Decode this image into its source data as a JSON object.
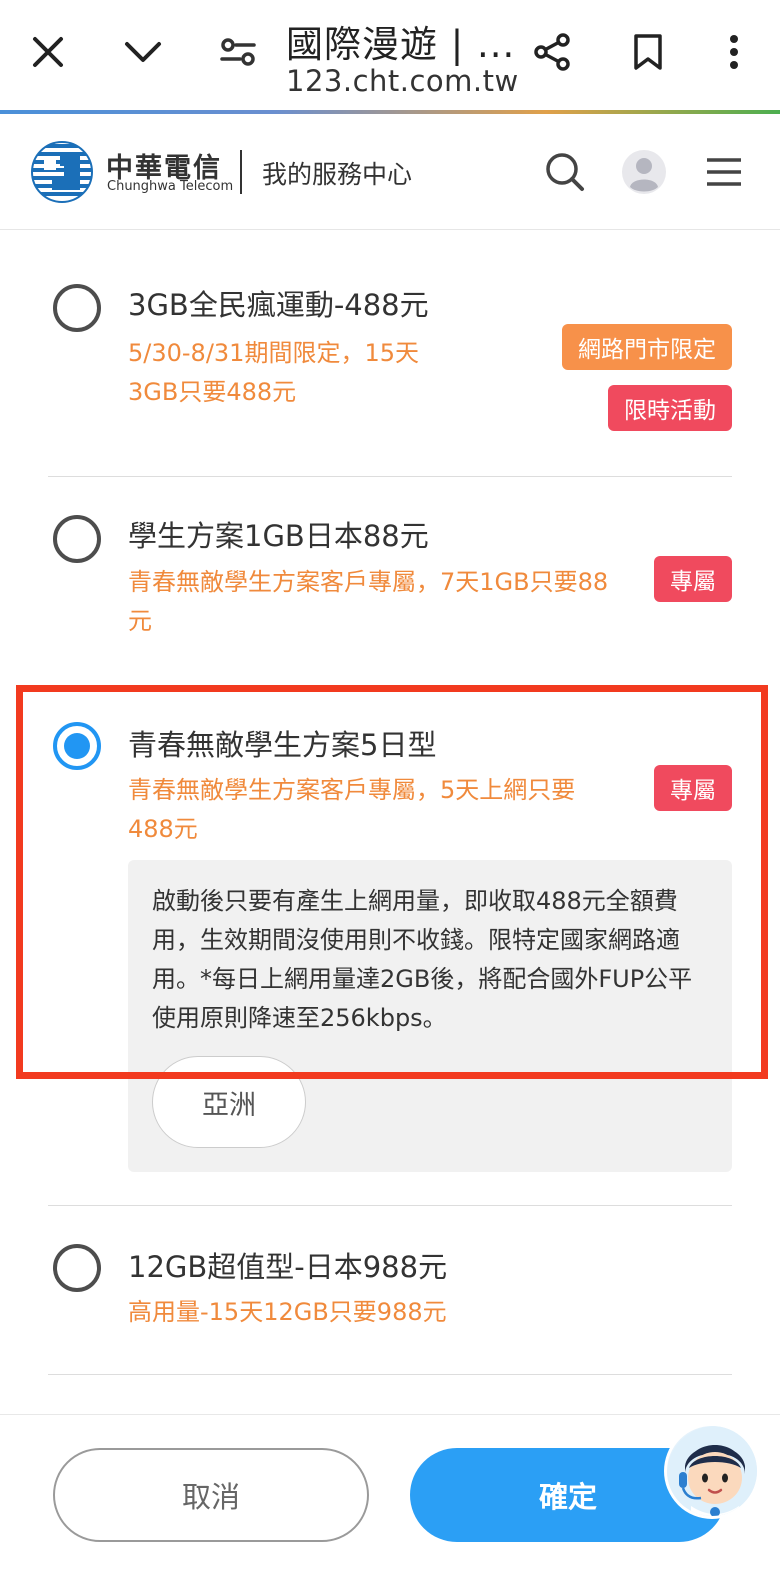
{
  "browser": {
    "title": "國際漫遊 | ...",
    "url": "123.cht.com.tw"
  },
  "header": {
    "brand_cn": "中華電信",
    "brand_en": "Chunghwa Telecom",
    "service_title": "我的服務中心"
  },
  "plans": [
    {
      "name": "3GB全民瘋運動-488元",
      "desc": "5/30-8/31期間限定，15天3GB只要488元",
      "badges": [
        "網路門市限定",
        "限時活動"
      ],
      "selected": false
    },
    {
      "name": "學生方案1GB日本88元",
      "desc": "青春無敵學生方案客戶專屬，7天1GB只要88元",
      "badges": [
        "專屬"
      ],
      "selected": false
    },
    {
      "name": "青春無敵學生方案5日型",
      "desc": "青春無敵學生方案客戶專屬，5天上網只要488元",
      "badges": [
        "專屬"
      ],
      "selected": true,
      "detail": "啟動後只要有產生上網用量，即收取488元全額費用，生效期間沒使用則不收錢。限特定國家網路適用。*每日上網用量達2GB後，將配合國外FUP公平使用原則降速至256kbps。",
      "region": "亞洲"
    },
    {
      "name": "12GB超值型-日本988元",
      "desc": "高用量-15天12GB只要988元",
      "badges": [],
      "selected": false
    }
  ],
  "actions": {
    "cancel": "取消",
    "confirm": "確定"
  },
  "colors": {
    "accent_blue": "#2b9ff5",
    "desc_orange": "#f08a3c",
    "badge_orange": "#f7914a",
    "badge_pink": "#f04a5e",
    "highlight_red": "#f23a1f"
  },
  "icons": [
    "close-icon",
    "chevron-down-icon",
    "page-settings-icon",
    "share-icon",
    "bookmark-icon",
    "more-vert-icon",
    "search-icon",
    "avatar-icon",
    "menu-icon",
    "mascot-icon"
  ]
}
